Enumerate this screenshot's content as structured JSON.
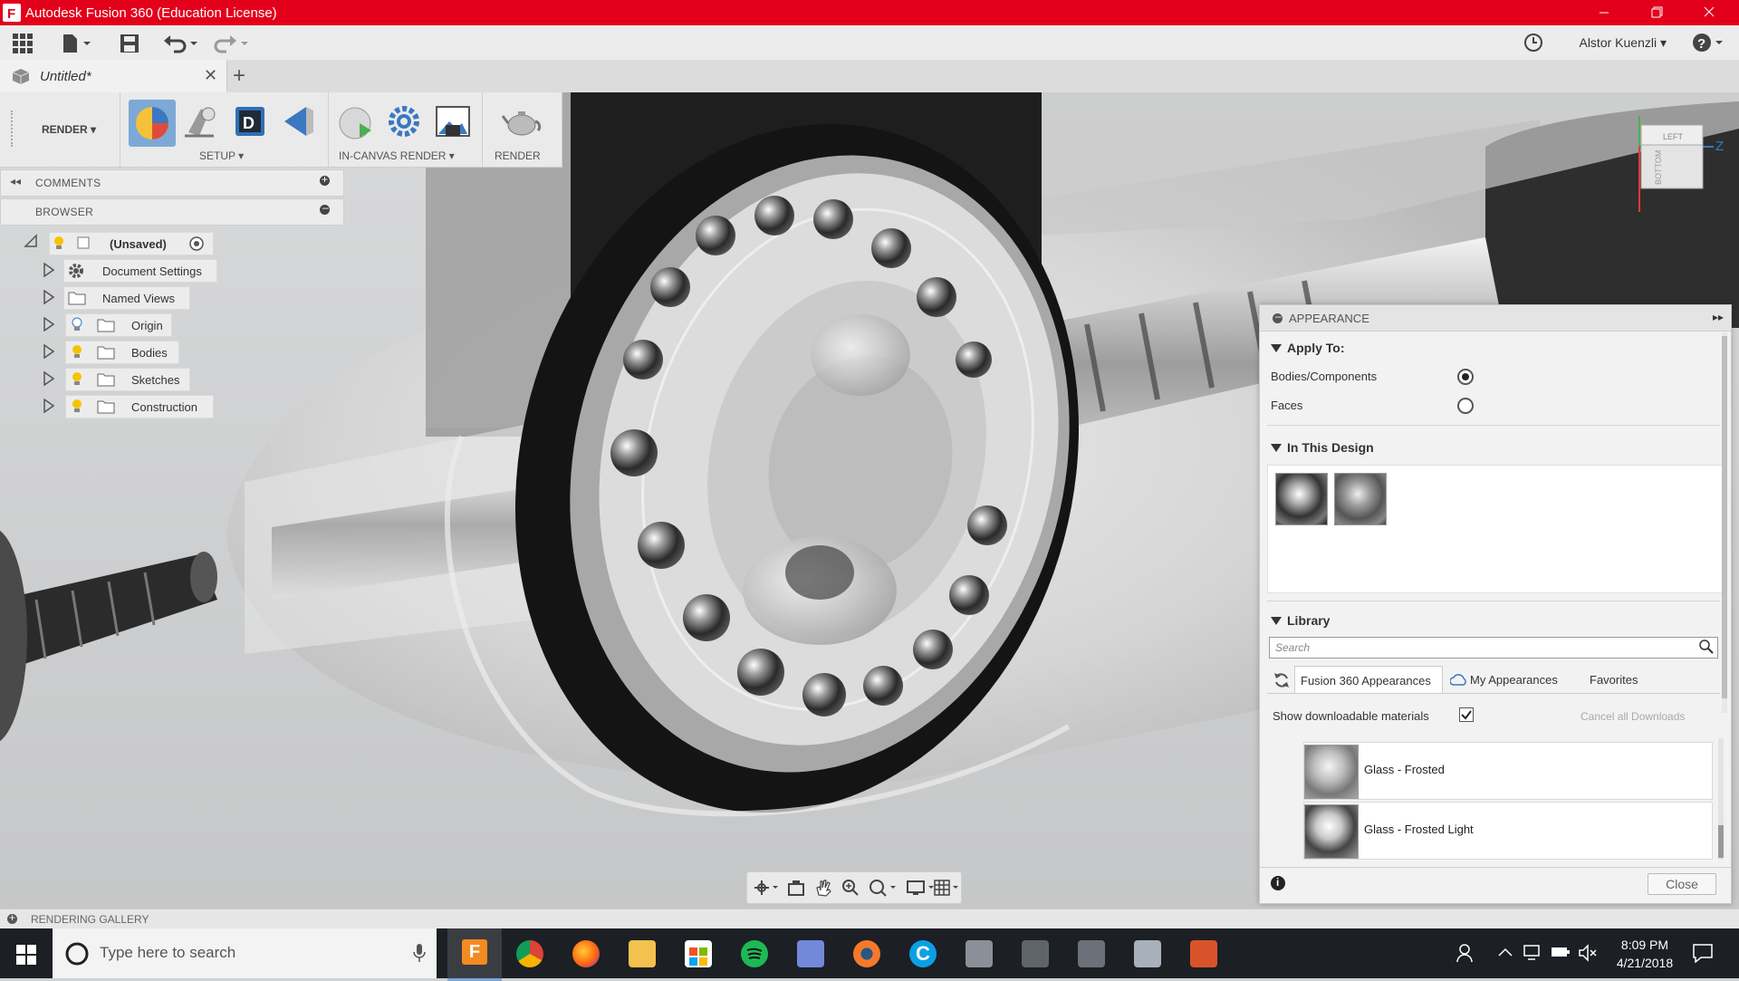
{
  "window": {
    "title": "Autodesk Fusion 360 (Education License)"
  },
  "quick_access": {
    "user_name": "Alstor Kuenzli ▾"
  },
  "document_tab": {
    "label": "Untitled*"
  },
  "toolbar": {
    "workspace": "RENDER ▾",
    "groups": {
      "setup": "SETUP ▾",
      "in_canvas": "IN-CANVAS RENDER ▾",
      "render": "RENDER"
    }
  },
  "panels": {
    "comments": "COMMENTS",
    "browser": "BROWSER"
  },
  "browser_tree": {
    "root": "(Unsaved)",
    "items": [
      "Document Settings",
      "Named Views",
      "Origin",
      "Bodies",
      "Sketches",
      "Construction"
    ]
  },
  "viewcube": {
    "left": "LEFT",
    "bottom": "BOTTOM",
    "z_axis": "Z"
  },
  "appearance": {
    "title": "APPEARANCE",
    "apply_to": {
      "title": "Apply To:",
      "options": [
        "Bodies/Components",
        "Faces"
      ],
      "selected": "Bodies/Components"
    },
    "in_design": {
      "title": "In This Design"
    },
    "library": {
      "title": "Library",
      "search_placeholder": "Search",
      "tabs": [
        "Fusion 360 Appearances",
        "My Appearances",
        "Favorites"
      ],
      "show_downloadable": "Show downloadable materials",
      "show_downloadable_checked": true,
      "cancel_downloads": "Cancel all Downloads",
      "materials": [
        "Glass - Frosted",
        "Glass - Frosted Light"
      ]
    },
    "close_label": "Close"
  },
  "gallery": {
    "label": "RENDERING GALLERY"
  },
  "taskbar": {
    "search_placeholder": "Type here to search",
    "time": "8:09 PM",
    "date": "4/21/2018"
  },
  "colors": {
    "titlebar": "#e3001b",
    "accent": "#3a78c2",
    "taskbar": "#1c1f24"
  }
}
